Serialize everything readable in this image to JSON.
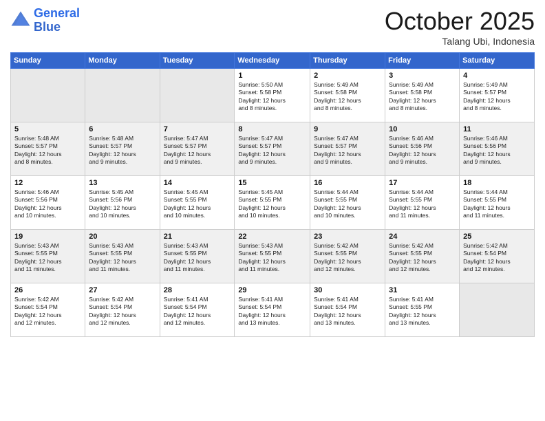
{
  "header": {
    "logo_line1": "General",
    "logo_line2": "Blue",
    "month": "October 2025",
    "location": "Talang Ubi, Indonesia"
  },
  "weekdays": [
    "Sunday",
    "Monday",
    "Tuesday",
    "Wednesday",
    "Thursday",
    "Friday",
    "Saturday"
  ],
  "weeks": [
    [
      {
        "day": "",
        "info": ""
      },
      {
        "day": "",
        "info": ""
      },
      {
        "day": "",
        "info": ""
      },
      {
        "day": "1",
        "info": "Sunrise: 5:50 AM\nSunset: 5:58 PM\nDaylight: 12 hours\nand 8 minutes."
      },
      {
        "day": "2",
        "info": "Sunrise: 5:49 AM\nSunset: 5:58 PM\nDaylight: 12 hours\nand 8 minutes."
      },
      {
        "day": "3",
        "info": "Sunrise: 5:49 AM\nSunset: 5:58 PM\nDaylight: 12 hours\nand 8 minutes."
      },
      {
        "day": "4",
        "info": "Sunrise: 5:49 AM\nSunset: 5:57 PM\nDaylight: 12 hours\nand 8 minutes."
      }
    ],
    [
      {
        "day": "5",
        "info": "Sunrise: 5:48 AM\nSunset: 5:57 PM\nDaylight: 12 hours\nand 8 minutes."
      },
      {
        "day": "6",
        "info": "Sunrise: 5:48 AM\nSunset: 5:57 PM\nDaylight: 12 hours\nand 9 minutes."
      },
      {
        "day": "7",
        "info": "Sunrise: 5:47 AM\nSunset: 5:57 PM\nDaylight: 12 hours\nand 9 minutes."
      },
      {
        "day": "8",
        "info": "Sunrise: 5:47 AM\nSunset: 5:57 PM\nDaylight: 12 hours\nand 9 minutes."
      },
      {
        "day": "9",
        "info": "Sunrise: 5:47 AM\nSunset: 5:57 PM\nDaylight: 12 hours\nand 9 minutes."
      },
      {
        "day": "10",
        "info": "Sunrise: 5:46 AM\nSunset: 5:56 PM\nDaylight: 12 hours\nand 9 minutes."
      },
      {
        "day": "11",
        "info": "Sunrise: 5:46 AM\nSunset: 5:56 PM\nDaylight: 12 hours\nand 9 minutes."
      }
    ],
    [
      {
        "day": "12",
        "info": "Sunrise: 5:46 AM\nSunset: 5:56 PM\nDaylight: 12 hours\nand 10 minutes."
      },
      {
        "day": "13",
        "info": "Sunrise: 5:45 AM\nSunset: 5:56 PM\nDaylight: 12 hours\nand 10 minutes."
      },
      {
        "day": "14",
        "info": "Sunrise: 5:45 AM\nSunset: 5:55 PM\nDaylight: 12 hours\nand 10 minutes."
      },
      {
        "day": "15",
        "info": "Sunrise: 5:45 AM\nSunset: 5:55 PM\nDaylight: 12 hours\nand 10 minutes."
      },
      {
        "day": "16",
        "info": "Sunrise: 5:44 AM\nSunset: 5:55 PM\nDaylight: 12 hours\nand 10 minutes."
      },
      {
        "day": "17",
        "info": "Sunrise: 5:44 AM\nSunset: 5:55 PM\nDaylight: 12 hours\nand 11 minutes."
      },
      {
        "day": "18",
        "info": "Sunrise: 5:44 AM\nSunset: 5:55 PM\nDaylight: 12 hours\nand 11 minutes."
      }
    ],
    [
      {
        "day": "19",
        "info": "Sunrise: 5:43 AM\nSunset: 5:55 PM\nDaylight: 12 hours\nand 11 minutes."
      },
      {
        "day": "20",
        "info": "Sunrise: 5:43 AM\nSunset: 5:55 PM\nDaylight: 12 hours\nand 11 minutes."
      },
      {
        "day": "21",
        "info": "Sunrise: 5:43 AM\nSunset: 5:55 PM\nDaylight: 12 hours\nand 11 minutes."
      },
      {
        "day": "22",
        "info": "Sunrise: 5:43 AM\nSunset: 5:55 PM\nDaylight: 12 hours\nand 11 minutes."
      },
      {
        "day": "23",
        "info": "Sunrise: 5:42 AM\nSunset: 5:55 PM\nDaylight: 12 hours\nand 12 minutes."
      },
      {
        "day": "24",
        "info": "Sunrise: 5:42 AM\nSunset: 5:55 PM\nDaylight: 12 hours\nand 12 minutes."
      },
      {
        "day": "25",
        "info": "Sunrise: 5:42 AM\nSunset: 5:54 PM\nDaylight: 12 hours\nand 12 minutes."
      }
    ],
    [
      {
        "day": "26",
        "info": "Sunrise: 5:42 AM\nSunset: 5:54 PM\nDaylight: 12 hours\nand 12 minutes."
      },
      {
        "day": "27",
        "info": "Sunrise: 5:42 AM\nSunset: 5:54 PM\nDaylight: 12 hours\nand 12 minutes."
      },
      {
        "day": "28",
        "info": "Sunrise: 5:41 AM\nSunset: 5:54 PM\nDaylight: 12 hours\nand 12 minutes."
      },
      {
        "day": "29",
        "info": "Sunrise: 5:41 AM\nSunset: 5:54 PM\nDaylight: 12 hours\nand 13 minutes."
      },
      {
        "day": "30",
        "info": "Sunrise: 5:41 AM\nSunset: 5:54 PM\nDaylight: 12 hours\nand 13 minutes."
      },
      {
        "day": "31",
        "info": "Sunrise: 5:41 AM\nSunset: 5:55 PM\nDaylight: 12 hours\nand 13 minutes."
      },
      {
        "day": "",
        "info": ""
      }
    ]
  ]
}
